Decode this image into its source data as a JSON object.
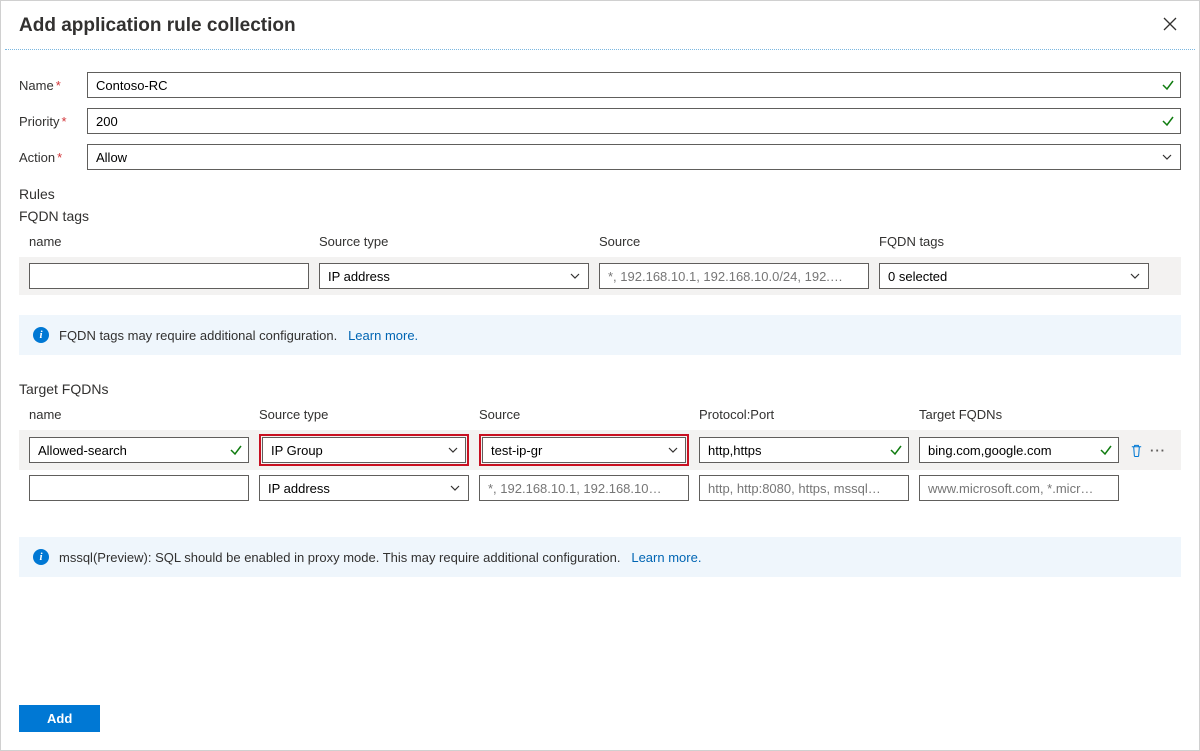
{
  "header": {
    "title": "Add application rule collection"
  },
  "form": {
    "name_label": "Name",
    "name_value": "Contoso-RC",
    "priority_label": "Priority",
    "priority_value": "200",
    "action_label": "Action",
    "action_value": "Allow"
  },
  "rules_heading": "Rules",
  "fqdn_tags": {
    "heading": "FQDN tags",
    "headers": {
      "name": "name",
      "source_type": "Source type",
      "source": "Source",
      "fqdn_tags": "FQDN tags"
    },
    "row": {
      "name": "",
      "source_type": "IP address",
      "source_placeholder": "*, 192.168.10.1, 192.168.10.0/24, 192.1...",
      "fqdn_tags_value": "0 selected"
    },
    "info_text": "FQDN tags may require additional configuration.",
    "learn_more": "Learn more."
  },
  "target_fqdns": {
    "heading": "Target FQDNs",
    "headers": {
      "name": "name",
      "source_type": "Source type",
      "source": "Source",
      "protocol_port": "Protocol:Port",
      "target_fqdns": "Target FQDNs"
    },
    "rows": [
      {
        "name": "Allowed-search",
        "source_type": "IP Group",
        "source": "test-ip-gr",
        "protocol_port": "http,https",
        "target_fqdns": "bing.com,google.com",
        "highlight_source_type": true,
        "highlight_source": true,
        "has_actions": true,
        "valid_name": true,
        "valid_protocol": true,
        "valid_target": true
      },
      {
        "name": "",
        "source_type": "IP address",
        "source_placeholder": "*, 192.168.10.1, 192.168.10.0/...",
        "protocol_placeholder": "http, http:8080, https, mssql:1...",
        "target_placeholder": "www.microsoft.com, *.micros..."
      }
    ],
    "info_text": "mssql(Preview): SQL should be enabled in proxy mode. This may require additional configuration.",
    "learn_more": "Learn more."
  },
  "footer": {
    "add_label": "Add"
  }
}
